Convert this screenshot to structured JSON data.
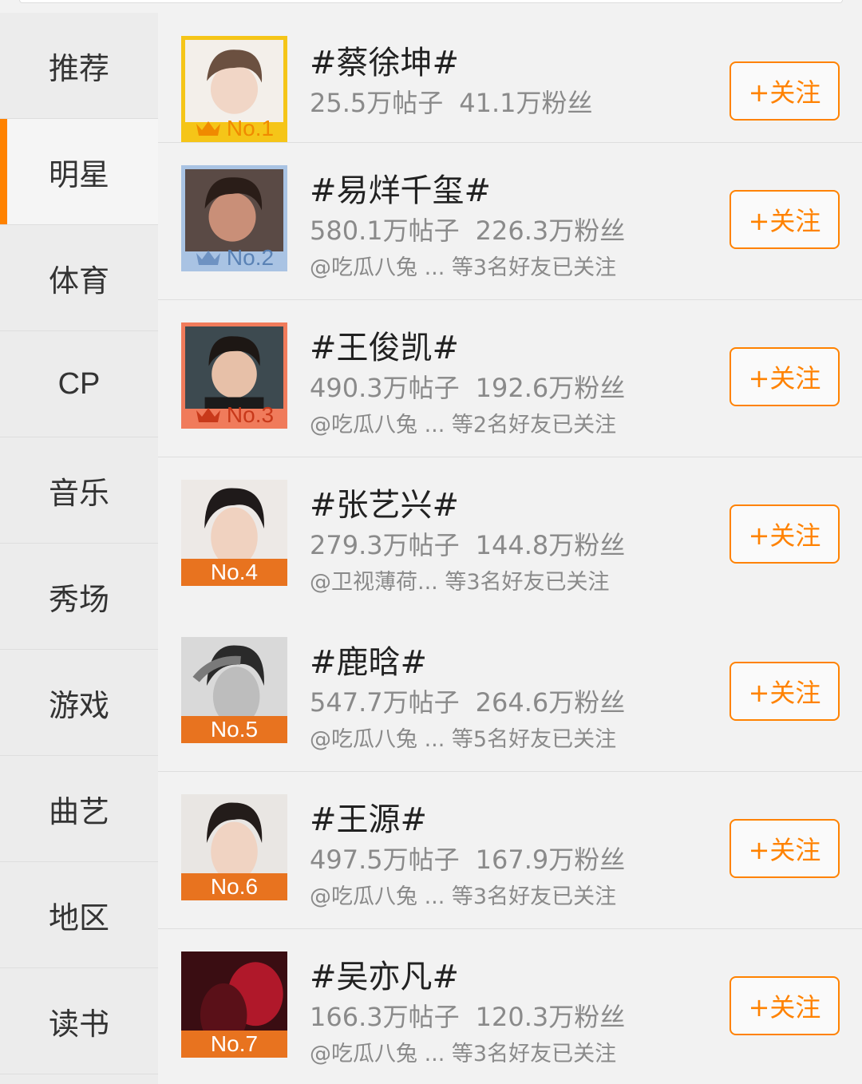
{
  "sidebar": {
    "items": [
      {
        "label": "推荐",
        "active": false
      },
      {
        "label": "明星",
        "active": true
      },
      {
        "label": "体育",
        "active": false
      },
      {
        "label": "CP",
        "active": false
      },
      {
        "label": "音乐",
        "active": false
      },
      {
        "label": "秀场",
        "active": false
      },
      {
        "label": "游戏",
        "active": false
      },
      {
        "label": "曲艺",
        "active": false
      },
      {
        "label": "地区",
        "active": false
      },
      {
        "label": "读书",
        "active": false
      }
    ]
  },
  "accent_color": "#ff8200",
  "follow_label": "+关注",
  "ranking": [
    {
      "rank": "No.1",
      "title": "#蔡徐坤#",
      "posts": "25.5万帖子",
      "fans": "41.1万粉丝",
      "friends": "",
      "badge_color": "#f5c518",
      "crown": "crown-icon",
      "photo_bg": "#f3efea"
    },
    {
      "rank": "No.2",
      "title": "#易烊千玺#",
      "posts": "580.1万帖子",
      "fans": "226.3万粉丝",
      "friends": "@吃瓜八兔 ... 等3名好友已关注",
      "badge_color": "#a9c3e3",
      "crown": "crown-icon",
      "photo_bg": "#5a4a45"
    },
    {
      "rank": "No.3",
      "title": "#王俊凯#",
      "posts": "490.3万帖子",
      "fans": "192.6万粉丝",
      "friends": "@吃瓜八兔 ... 等2名好友已关注",
      "badge_color": "#f07b5b",
      "crown": "crown-icon",
      "photo_bg": "#3d4a50"
    },
    {
      "rank": "No.4",
      "title": "#张艺兴#",
      "posts": "279.3万帖子",
      "fans": "144.8万粉丝",
      "friends": "@卫视薄荷... 等3名好友已关注",
      "badge_color": "#e8731f",
      "crown": "",
      "photo_bg": "#ede9e6"
    },
    {
      "rank": "No.5",
      "title": "#鹿晗#",
      "posts": "547.7万帖子",
      "fans": "264.6万粉丝",
      "friends": "@吃瓜八兔 ... 等5名好友已关注",
      "badge_color": "#e8731f",
      "crown": "",
      "photo_bg": "#d9d9d9"
    },
    {
      "rank": "No.6",
      "title": "#王源#",
      "posts": "497.5万帖子",
      "fans": "167.9万粉丝",
      "friends": "@吃瓜八兔 ... 等3名好友已关注",
      "badge_color": "#e8731f",
      "crown": "",
      "photo_bg": "#e9e6e3"
    },
    {
      "rank": "No.7",
      "title": "#吴亦凡#",
      "posts": "166.3万帖子",
      "fans": "120.3万粉丝",
      "friends": "@吃瓜八兔 ... 等3名好友已关注",
      "badge_color": "#e8731f",
      "crown": "",
      "photo_bg": "#3a0d12"
    }
  ]
}
